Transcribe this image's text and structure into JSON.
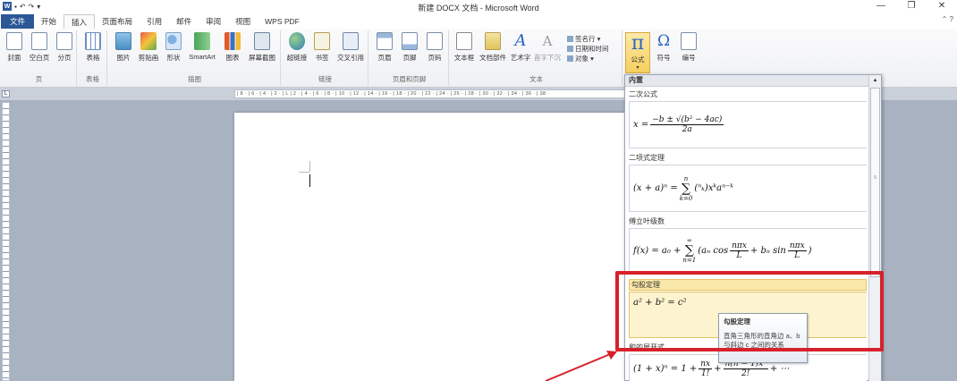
{
  "window": {
    "title": "新建 DOCX 文档 - Microsoft Word",
    "controls": [
      "—",
      "❐",
      "✕"
    ]
  },
  "quick_access": [
    "W",
    "▪",
    "↶",
    "↷",
    "▾"
  ],
  "tabs": [
    "文件",
    "开始",
    "插入",
    "页面布局",
    "引用",
    "邮件",
    "审阅",
    "视图",
    "WPS PDF"
  ],
  "active_tab": "插入",
  "ribbon": {
    "groups": {
      "pages": {
        "label": "页",
        "buttons": [
          "封面",
          "空白页",
          "分页"
        ]
      },
      "tables": {
        "label": "表格",
        "buttons": [
          "表格"
        ]
      },
      "illustrations": {
        "label": "插图",
        "buttons": [
          "图片",
          "剪贴画",
          "形状",
          "SmartArt",
          "图表",
          "屏幕截图"
        ]
      },
      "links": {
        "label": "链接",
        "buttons": [
          "超链接",
          "书签",
          "交叉引用"
        ]
      },
      "header_footer": {
        "label": "页眉和页脚",
        "buttons": [
          "页眉",
          "页脚",
          "页码"
        ]
      },
      "text": {
        "label": "文本",
        "buttons": [
          "文本框",
          "文档部件",
          "艺术字",
          "首字下沉"
        ],
        "small": [
          "签名行 ▾",
          "日期和时间",
          "对象 ▾"
        ]
      },
      "symbols": {
        "equation": "公式",
        "equation_glyph": "π",
        "symbol": "符号",
        "symbol_glyph": "Ω",
        "number": "编号"
      }
    }
  },
  "ruler": {
    "corner": "L",
    "ticks": "| 8 · | 6 · | 4 · | 2 · | L | 2 · | 4 · | 6 · | 8 · | 10 · | 12 · | 14 · | 16 · | 18 · | 20 · | 22 · | 24 · | 26 · | 28 · | 30 · | 32 · | 34 · | 36 · | 38 ·"
  },
  "gallery": {
    "header": "内置",
    "items": [
      {
        "title": "二次公式"
      },
      {
        "title": "二项式定理"
      },
      {
        "title": "傅立叶级数"
      },
      {
        "title": "勾股定理"
      },
      {
        "title": "和的展开式"
      }
    ]
  },
  "equations": {
    "quadratic": {
      "lhs": "x =",
      "num": "−b ± √(b² − 4ac)",
      "den": "2a"
    },
    "binomial": {
      "lhs": "(x + a)ⁿ =",
      "sum_top": "n",
      "sum_bot": "k=0",
      "body": "(ⁿₖ)xᵏaⁿ⁻ᵏ"
    },
    "fourier": {
      "lhs": "f(x) = a₀ +",
      "sum_top": "∞",
      "sum_bot": "n=1",
      "body_a": "(aₙ cos",
      "frac1_n": "nπx",
      "frac1_d": "L",
      "mid": "+ bₙ sin",
      "frac2_n": "nπx",
      "frac2_d": "L",
      "close": ")"
    },
    "pythagorean": "a² + b² = c²",
    "expansion": {
      "lhs": "(1 + x)ⁿ = 1 +",
      "frac1_n": "nx",
      "frac1_d": "1!",
      "mid": "+",
      "frac2_n": "n(n − 1)x²",
      "frac2_d": "2!",
      "tail": "+ ⋯"
    }
  },
  "tooltip": {
    "title": "勾股定理",
    "body": "直角三角形的直角边 a、b 与斜边 c 之间的关系"
  },
  "colors": {
    "accent": "#2b5797",
    "highlight": "#d6212b",
    "selection": "#fae8a8"
  }
}
